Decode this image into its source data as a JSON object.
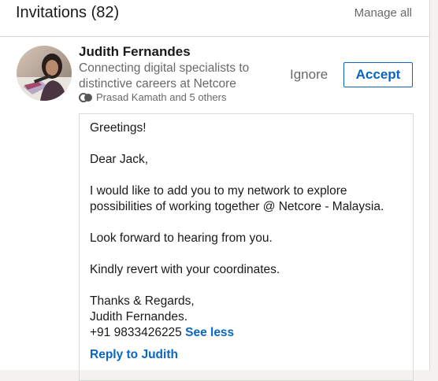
{
  "header": {
    "title": "Invitations (82)",
    "manage_label": "Manage all"
  },
  "invitation": {
    "name": "Judith Fernandes",
    "headline": "Connecting digital specialists to distinctive careers at Netcore",
    "mutual_text": "Prasad Kamath and 5 others",
    "avatar_icon": "person-photo",
    "mutual_icon": "mutual-connections-icon",
    "ignore_label": "Ignore",
    "accept_label": "Accept",
    "message": {
      "greeting": "Greetings!",
      "salutation": "Dear Jack,",
      "body": "I would like to add you to my network to explore possibilities of working together @ Netcore - Malaysia.",
      "line1": "Look forward to hearing from you.",
      "line2": "Kindly revert with your coordinates.",
      "closing": "Thanks & Regards,",
      "signature_name": "Judith Fernandes.",
      "phone": "+91 9833426225",
      "see_less_label": "See less",
      "reply_label": "Reply to Judith"
    }
  },
  "colors": {
    "accent": "#0a66c2",
    "divider": "#d9d9d9",
    "muted_text": "#666666"
  }
}
